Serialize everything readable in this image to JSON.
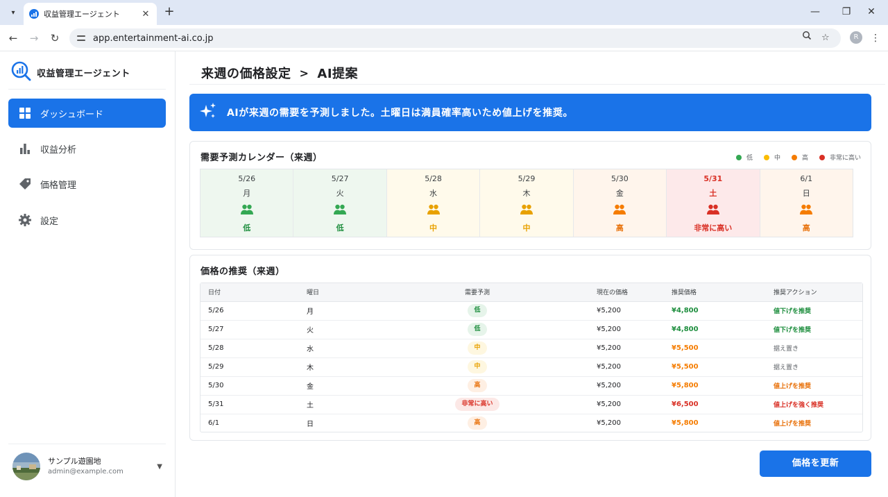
{
  "browser": {
    "tab_title": "収益管理エージェント",
    "url": "app.entertainment-ai.co.jp",
    "profile_initial": "R"
  },
  "sidebar": {
    "app_title": "収益管理エージェント",
    "items": [
      {
        "label": "ダッシュボード",
        "icon": "dashboard-icon",
        "active": true
      },
      {
        "label": "収益分析",
        "icon": "bar-chart-icon",
        "active": false
      },
      {
        "label": "価格管理",
        "icon": "price-tag-icon",
        "active": false
      },
      {
        "label": "設定",
        "icon": "gear-icon",
        "active": false
      }
    ],
    "user": {
      "name": "サンプル遊園地",
      "email": "admin@example.com"
    }
  },
  "header": {
    "title": "来週の価格設定",
    "separator": ">",
    "subtitle": "AI提案"
  },
  "banner": {
    "text": "AIが来週の需要を予測しました。土曜日は満員確率高いため値上げを推奨。",
    "color": "#1a73e8"
  },
  "demand_calendar": {
    "title": "需要予測カレンダー（来週）",
    "legend": [
      {
        "label": "低",
        "color": "#34a853"
      },
      {
        "label": "中",
        "color": "#fbbc04"
      },
      {
        "label": "高",
        "color": "#f57c00"
      },
      {
        "label": "非常に高い",
        "color": "#d93025"
      }
    ],
    "days": [
      {
        "date": "5/26",
        "dow": "月",
        "level": "低",
        "tone": "low"
      },
      {
        "date": "5/27",
        "dow": "火",
        "level": "低",
        "tone": "low"
      },
      {
        "date": "5/28",
        "dow": "水",
        "level": "中",
        "tone": "mid"
      },
      {
        "date": "5/29",
        "dow": "木",
        "level": "中",
        "tone": "mid"
      },
      {
        "date": "5/30",
        "dow": "金",
        "level": "高",
        "tone": "high"
      },
      {
        "date": "5/31",
        "dow": "土",
        "level": "非常に高い",
        "tone": "vhigh"
      },
      {
        "date": "6/1",
        "dow": "日",
        "level": "高",
        "tone": "high"
      }
    ]
  },
  "recommendation": {
    "title": "価格の推奨（来週）",
    "columns": [
      "日付",
      "曜日",
      "需要予測",
      "現在の価格",
      "推奨価格",
      "推奨アクション"
    ],
    "rows": [
      {
        "date": "5/26",
        "dow": "月",
        "demand": "低",
        "tone": "low",
        "current": "¥5,200",
        "recommended": "¥4,800",
        "action": "値下げを推奨",
        "action_tone": "down"
      },
      {
        "date": "5/27",
        "dow": "火",
        "demand": "低",
        "tone": "low",
        "current": "¥5,200",
        "recommended": "¥4,800",
        "action": "値下げを推奨",
        "action_tone": "down"
      },
      {
        "date": "5/28",
        "dow": "水",
        "demand": "中",
        "tone": "mid",
        "current": "¥5,200",
        "recommended": "¥5,500",
        "action": "据え置き",
        "action_tone": "keep"
      },
      {
        "date": "5/29",
        "dow": "木",
        "demand": "中",
        "tone": "mid",
        "current": "¥5,200",
        "recommended": "¥5,500",
        "action": "据え置き",
        "action_tone": "keep"
      },
      {
        "date": "5/30",
        "dow": "金",
        "demand": "高",
        "tone": "high",
        "current": "¥5,200",
        "recommended": "¥5,800",
        "action": "値上げを推奨",
        "action_tone": "up"
      },
      {
        "date": "5/31",
        "dow": "土",
        "demand": "非常に高い",
        "tone": "vhigh",
        "current": "¥5,200",
        "recommended": "¥6,500",
        "action": "値上げを強く推奨",
        "action_tone": "strong"
      },
      {
        "date": "6/1",
        "dow": "日",
        "demand": "高",
        "tone": "high",
        "current": "¥5,200",
        "recommended": "¥5,800",
        "action": "値上げを推奨",
        "action_tone": "up"
      }
    ]
  },
  "actions": {
    "update_label": "価格を更新"
  },
  "colors": {
    "accent": "#1a73e8",
    "low": "#34a853",
    "mid": "#e8a100",
    "high": "#f57c00",
    "very_high": "#d93025"
  }
}
